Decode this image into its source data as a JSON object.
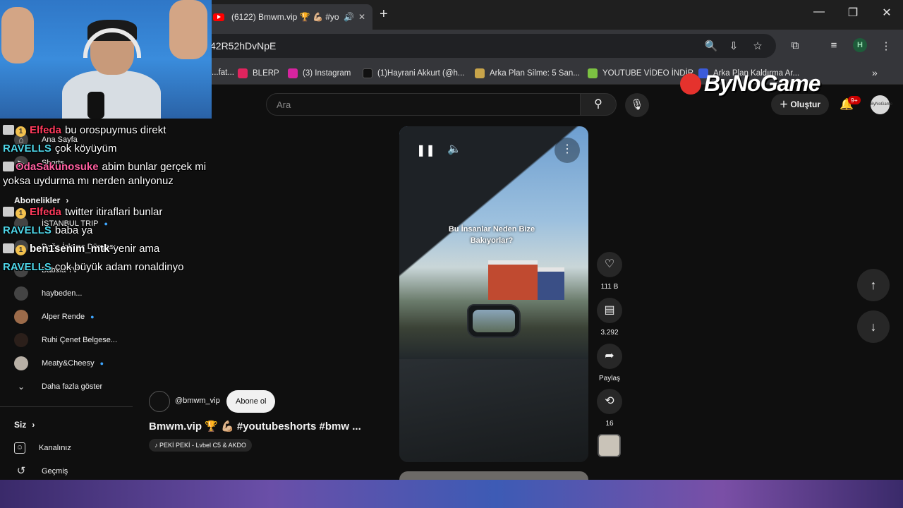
{
  "browser": {
    "tab_title": "(6122) Bmwm.vip 🏆 💪🏼 #you",
    "url_partial": "42R52hDvNpE",
    "bookmarks": [
      {
        "label": "...fat...",
        "color": "#2b6cb0"
      },
      {
        "label": "BLERP",
        "color": "#e0245e"
      },
      {
        "label": "(3) Instagram",
        "color": "#d6249f"
      },
      {
        "label": "(1)Hayrani Akkurt (@h...",
        "color": "#111111"
      },
      {
        "label": "Arka Plan Silme: 5 San...",
        "color": "#c8a44a"
      },
      {
        "label": "YOUTUBE VİDEO İNDİR",
        "color": "#7cc242"
      },
      {
        "label": "Arka Plan Kaldırma Ar...",
        "color": "#3b5bdb"
      }
    ],
    "profile_initial": "H"
  },
  "youtube": {
    "search_placeholder": "Ara",
    "create_label": "Oluştur",
    "notifications_badge": "9+",
    "avatar_text": "ByNoGame",
    "sidebar": {
      "home": "Ana Sayfa",
      "shorts": "Shorts",
      "subscriptions_header": "Abonelikler",
      "subscriptions": [
        {
          "label": "İSTANBUL TRIP",
          "live": true
        },
        {
          "label": "Doğa İzleme Dünyası",
          "live": false
        },
        {
          "label": "Babala TV",
          "live": false
        },
        {
          "label": "haybeden...",
          "live": false
        },
        {
          "label": "Alper Rende",
          "live": true
        },
        {
          "label": "Ruhi Çenet Belgese...",
          "live": false
        },
        {
          "label": "Meaty&Cheesy",
          "live": true
        }
      ],
      "show_more": "Daha fazla göster",
      "you_header": "Siz",
      "your_channel": "Kanalınız",
      "history": "Geçmiş"
    },
    "short": {
      "overlay_text_line1": "Bu İnsanlar Neden Bize",
      "overlay_text_line2": "Bakıyorlar?",
      "likes": "111 B",
      "comments": "3.292",
      "share": "Paylaş",
      "remix_count": "16",
      "channel": "@bmwm_vip",
      "subscribe": "Abone ol",
      "title": "Bmwm.vip 🏆 💪🏼 #youtubeshorts #bmw ...",
      "music": "♪ PEKİ PEKİ - Lvbel C5 & AKDO"
    }
  },
  "stream": {
    "watermark": "ByNoGame",
    "chat": [
      {
        "user": "Elfeda",
        "color": "#ff3b5c",
        "tier": "1",
        "msg": "bu orospuymus direkt"
      },
      {
        "user": "RAVELLS",
        "color": "#4fd6e8",
        "tier": "",
        "msg": "çok köyüyüm"
      },
      {
        "user": "OdaSakunosuke",
        "color": "#ff5fa0",
        "tier": "",
        "msg": "abim bunlar gerçek mi yoksa uydurma mı nerden anlıyonuz"
      },
      {
        "user": "Elfeda",
        "color": "#ff3b5c",
        "tier": "1",
        "msg": "twitter itiraflari bunlar"
      },
      {
        "user": "RAVELLS",
        "color": "#4fd6e8",
        "tier": "",
        "msg": "baba ya"
      },
      {
        "user": "ben1senim_mtk",
        "color": "#ffffff",
        "tier": "1",
        "msg": "yenir ama"
      },
      {
        "user": "RAVELLS",
        "color": "#4fd6e8",
        "tier": "",
        "msg": "çok büyük adam ronaldinyo"
      }
    ]
  }
}
